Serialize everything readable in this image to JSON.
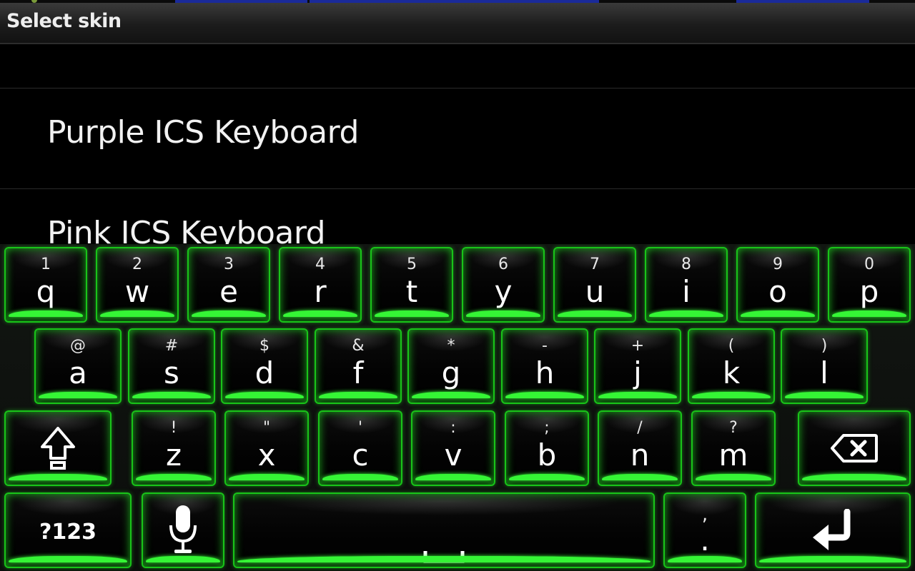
{
  "dialog": {
    "title": "Select skin"
  },
  "skins": [
    {
      "label": "Purple ICS Keyboard"
    },
    {
      "label": "Pink ICS Keyboard"
    }
  ],
  "keyboard": {
    "accent_color": "#35f535",
    "rows": [
      [
        {
          "secondary": "1",
          "primary": "q"
        },
        {
          "secondary": "2",
          "primary": "w"
        },
        {
          "secondary": "3",
          "primary": "e"
        },
        {
          "secondary": "4",
          "primary": "r"
        },
        {
          "secondary": "5",
          "primary": "t"
        },
        {
          "secondary": "6",
          "primary": "y"
        },
        {
          "secondary": "7",
          "primary": "u"
        },
        {
          "secondary": "8",
          "primary": "i"
        },
        {
          "secondary": "9",
          "primary": "o"
        },
        {
          "secondary": "0",
          "primary": "p"
        }
      ],
      [
        {
          "secondary": "@",
          "primary": "a"
        },
        {
          "secondary": "#",
          "primary": "s"
        },
        {
          "secondary": "$",
          "primary": "d"
        },
        {
          "secondary": "&",
          "primary": "f"
        },
        {
          "secondary": "*",
          "primary": "g"
        },
        {
          "secondary": "-",
          "primary": "h"
        },
        {
          "secondary": "+",
          "primary": "j"
        },
        {
          "secondary": "(",
          "primary": "k"
        },
        {
          "secondary": ")",
          "primary": "l"
        }
      ],
      [
        {
          "secondary": "!",
          "primary": "z"
        },
        {
          "secondary": "\"",
          "primary": "x"
        },
        {
          "secondary": "'",
          "primary": "c"
        },
        {
          "secondary": ":",
          "primary": "v"
        },
        {
          "secondary": ";",
          "primary": "b"
        },
        {
          "secondary": "/",
          "primary": "n"
        },
        {
          "secondary": "?",
          "primary": "m"
        }
      ]
    ],
    "shift_icon": "shift-arrow-up-icon",
    "backspace_icon": "backspace-icon",
    "symbols_label": "?123",
    "mic_icon": "microphone-icon",
    "space_icon": "space-bar-icon",
    "comma_label": ",",
    "period_label": ".",
    "enter_icon": "enter-return-icon"
  }
}
